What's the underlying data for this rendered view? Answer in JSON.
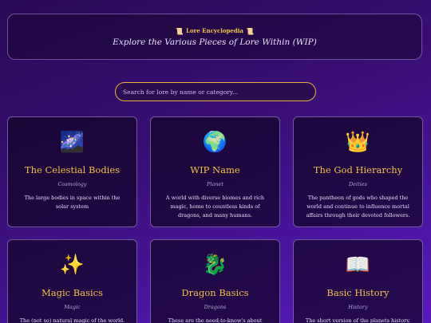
{
  "header": {
    "scroll_icon_left": "📜",
    "badge": "Lore Encyclopedia",
    "scroll_icon_right": "📜",
    "subtitle": "Explore the Various Pieces of Lore Within (WIP)"
  },
  "search": {
    "placeholder": "Search for lore by name or category..."
  },
  "colors": {
    "accent_gold": "#f2c14a",
    "search_border": "#e8b13c",
    "background_start": "#2a0a55",
    "background_end": "#5a18c0"
  },
  "cards": [
    {
      "icon": "🌌",
      "icon_name": "galaxy-icon",
      "title": "The Celestial Bodies",
      "category": "Cosmology",
      "description": "The large bodies in space within the solar system"
    },
    {
      "icon": "🌍",
      "icon_name": "globe-icon",
      "title": "WIP Name",
      "category": "Planet",
      "description": "A world with diverse biomes and rich magic, home to countless kinds of dragons, and many humans."
    },
    {
      "icon": "👑",
      "icon_name": "crown-icon",
      "title": "The God Hierarchy",
      "category": "Deities",
      "description": "The pantheon of gods who shaped the world and continue to influence mortal affairs through their devoted followers."
    },
    {
      "icon": "✨",
      "icon_name": "sparkles-icon",
      "title": "Magic Basics",
      "category": "Magic",
      "description": "The (not so) natural magic of the world."
    },
    {
      "icon": "🐉",
      "icon_name": "dragon-icon",
      "title": "Dragon Basics",
      "category": "Dragons",
      "description": "These are the need-to-know's about dragons on"
    },
    {
      "icon": "📖",
      "icon_name": "open-book-icon",
      "title": "Basic History",
      "category": "History",
      "description": "The short version of the planets history."
    }
  ]
}
